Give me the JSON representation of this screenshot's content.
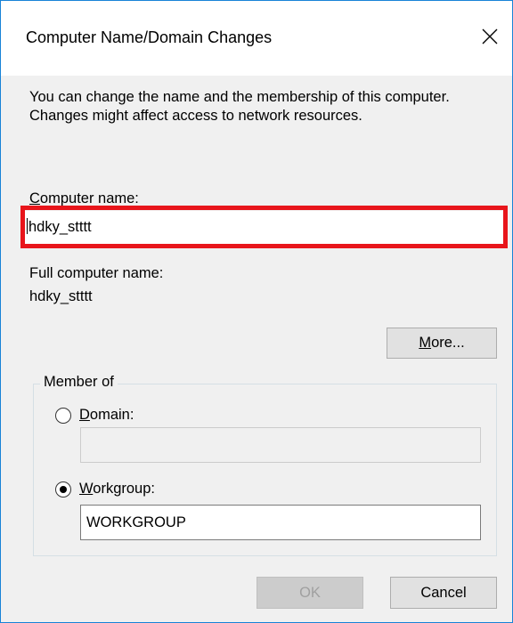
{
  "dialog": {
    "title": "Computer Name/Domain Changes",
    "description": "You can change the name and the membership of this computer. Changes might affect access to network resources."
  },
  "computer_name": {
    "label": "Computer name:",
    "value": "hdky_stttt"
  },
  "full_name": {
    "label": "Full computer name:",
    "value": "hdky_stttt"
  },
  "buttons": {
    "more": "More...",
    "ok": "OK",
    "cancel": "Cancel"
  },
  "member_of": {
    "legend": "Member of",
    "domain": {
      "label": "Domain:",
      "value": "",
      "selected": false
    },
    "workgroup": {
      "label": "Workgroup:",
      "value": "WORKGROUP",
      "selected": true
    }
  },
  "icons": {
    "close": "close-icon"
  },
  "colors": {
    "highlight": "#e8151b",
    "window_border": "#1883d7"
  }
}
